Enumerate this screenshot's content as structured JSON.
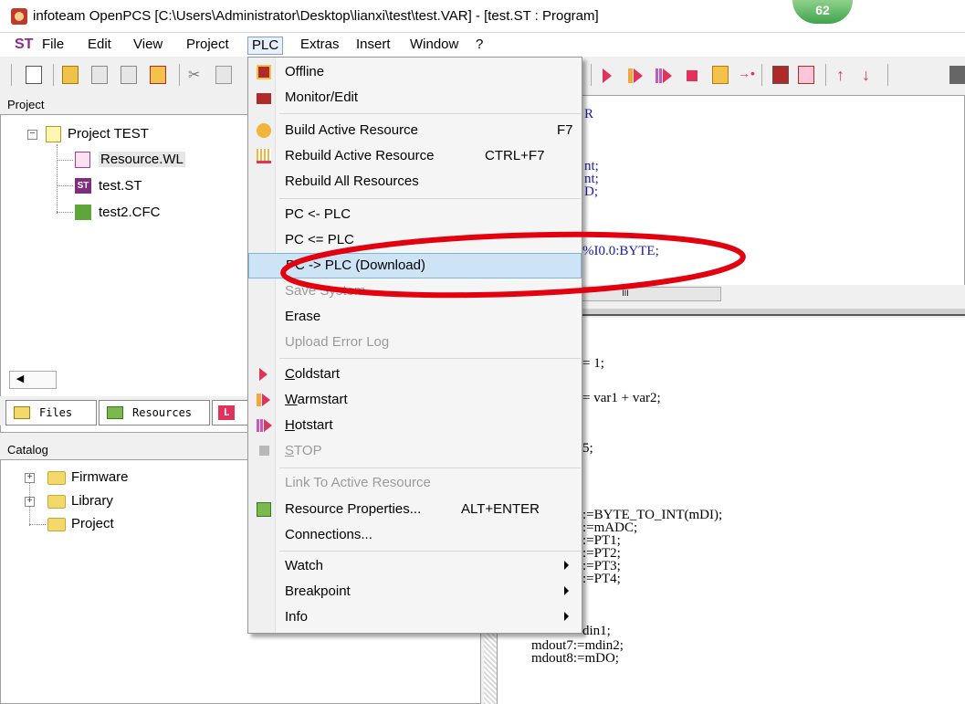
{
  "window": {
    "title": "infoteam OpenPCS [C:\\Users\\Administrator\\Desktop\\lianxi\\test\\test.VAR]  - [test.ST : Program]",
    "badge": "62"
  },
  "menubar": {
    "st_label": "ST",
    "items": [
      "File",
      "Edit",
      "View",
      "Project",
      "PLC",
      "Extras",
      "Insert",
      "Window",
      "?"
    ]
  },
  "project_panel": {
    "header": "Project",
    "root": "Project TEST",
    "items": [
      "Resource.WL",
      "test.ST",
      "test2.CFC"
    ]
  },
  "tabs": [
    "Files",
    "Resources"
  ],
  "catalog_panel": {
    "header": "Catalog",
    "items": [
      "Firmware",
      "Library",
      "Project"
    ]
  },
  "editor_top": {
    "lines": [
      "R",
      "nt;",
      "nt;",
      "D;",
      "%I0.0:BYTE;"
    ],
    "scroll_thumb": "III"
  },
  "editor_bottom": {
    "lines": [
      "= 1;",
      "= var1 + var2;",
      "5;",
      ":=BYTE_TO_INT(mDI);",
      ":=mADC;",
      ":=PT1;",
      ":=PT2;",
      ":=PT3;",
      ":=PT4;",
      "din1;",
      "mdout7:=mdin2;",
      "mdout8:=mDO;"
    ]
  },
  "plc_menu": {
    "offline": "Offline",
    "monitor_edit": "Monitor/Edit",
    "build_active": "Build Active Resource",
    "build_active_shortcut": "F7",
    "rebuild_active": "Rebuild Active Resource",
    "rebuild_active_shortcut": "CTRL+F7",
    "rebuild_all": "Rebuild All Resources",
    "pc_from_plc": "PC <- PLC",
    "pc_eq_plc": "PC <= PLC",
    "pc_to_plc_download": "PC -> PLC (Download)",
    "save_system": "Save System...",
    "erase": "Erase",
    "upload_error_log": "Upload Error Log",
    "coldstart_u": "C",
    "coldstart_rest": "oldstart",
    "warmstart_u": "W",
    "warmstart_rest": "armstart",
    "hotstart_u": "H",
    "hotstart_rest": "otstart",
    "stop_u": "S",
    "stop_rest": "TOP",
    "link_active": "Link To Active Resource",
    "resource_properties": "Resource Properties...",
    "resource_properties_shortcut": "ALT+ENTER",
    "connections": "Connections...",
    "watch": "Watch",
    "breakpoint": "Breakpoint",
    "info": "Info"
  },
  "colors": {
    "annotation": "#e3000f",
    "menu_highlight": "#cde4f7",
    "run_red": "#e0335b"
  }
}
